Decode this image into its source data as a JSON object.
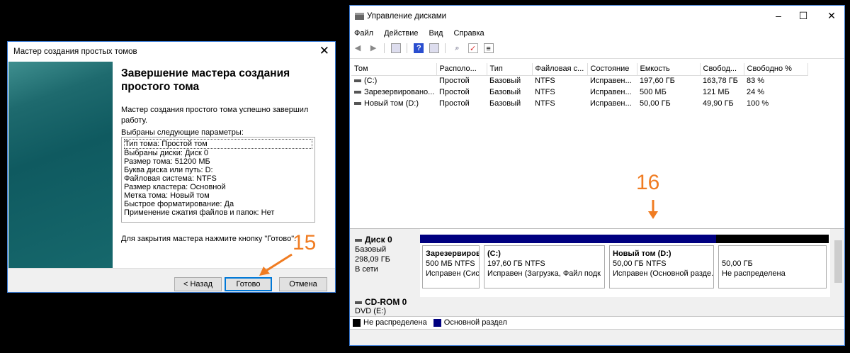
{
  "wizard": {
    "title": "Мастер создания простых томов",
    "heading": "Завершение мастера создания простого тома",
    "success": "Мастер создания простого тома успешно завершил работу.",
    "params_label": "Выбраны следующие параметры:",
    "params": [
      "Тип тома: Простой том",
      "Выбраны диски: Диск 0",
      "Размер тома: 51200 МБ",
      "Буква диска или путь: D:",
      "Файловая система: NTFS",
      "Размер кластера: Основной",
      "Метка тома: Новый том",
      "Быстрое форматирование: Да",
      "Применение сжатия файлов и папок: Нет"
    ],
    "close_hint": "Для закрытия мастера нажмите кнопку \"Готово\".",
    "back": "< Назад",
    "finish": "Готово",
    "cancel": "Отмена",
    "annotation": "15"
  },
  "diskmgmt": {
    "title": "Управление дисками",
    "menu": [
      "Файл",
      "Действие",
      "Вид",
      "Справка"
    ],
    "columns": [
      "Том",
      "Располо...",
      "Тип",
      "Файловая с...",
      "Состояние",
      "Емкость",
      "Свобод...",
      "Свободно %"
    ],
    "rows": [
      [
        "(C:)",
        "Простой",
        "Базовый",
        "NTFS",
        "Исправен...",
        "197,60 ГБ",
        "163,78 ГБ",
        "83 %"
      ],
      [
        "Зарезервировано...",
        "Простой",
        "Базовый",
        "NTFS",
        "Исправен...",
        "500 МБ",
        "121 МБ",
        "24 %"
      ],
      [
        "Новый том (D:)",
        "Простой",
        "Базовый",
        "NTFS",
        "Исправен...",
        "50,00 ГБ",
        "49,90 ГБ",
        "100 %"
      ]
    ],
    "annotation": "16",
    "disk0": {
      "name": "Диск 0",
      "type": "Базовый",
      "size": "298,09 ГБ",
      "status": "В сети"
    },
    "partitions": [
      {
        "name": "Зарезервиров",
        "size": "500 МБ NTFS",
        "status": "Исправен (Сис"
      },
      {
        "name": "(C:)",
        "size": "197,60 ГБ NTFS",
        "status": "Исправен (Загрузка, Файл подк"
      },
      {
        "name": "Новый том  (D:)",
        "size": "50,00 ГБ NTFS",
        "status": "Исправен (Основной разде."
      },
      {
        "name": "",
        "size": "50,00 ГБ",
        "status": "Не распределена"
      }
    ],
    "cdrom": {
      "name": "CD-ROM 0",
      "sub": "DVD (E:)"
    },
    "legend": [
      "Не распределена",
      "Основной раздел"
    ],
    "colors": {
      "primary": "#000080",
      "unallocated": "#000000",
      "annotation": "#f07c22"
    }
  }
}
